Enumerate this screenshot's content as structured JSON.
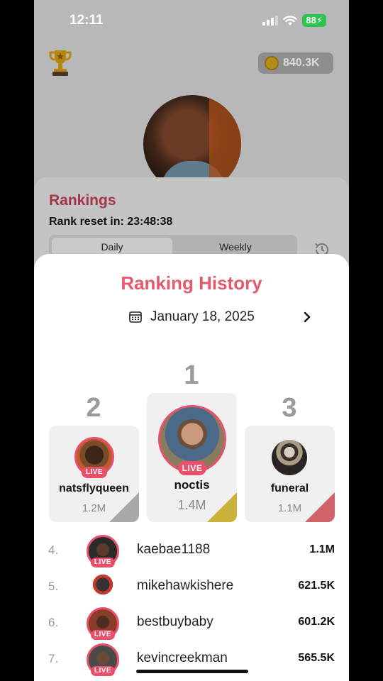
{
  "status": {
    "time": "12:11",
    "battery": "88"
  },
  "header": {
    "coins": "840.3K"
  },
  "rankings": {
    "title": "Rankings",
    "reset_text": "Rank reset in: 23:48:38",
    "tabs": [
      "Daily",
      "Weekly"
    ]
  },
  "history": {
    "title": "Ranking History",
    "date": "January 18, 2025",
    "podium": [
      {
        "place": "1",
        "name": "noctis",
        "score": "1.4M",
        "live": "LIVE"
      },
      {
        "place": "2",
        "name": "natsflyqueen",
        "score": "1.2M",
        "live": "LIVE"
      },
      {
        "place": "3",
        "name": "funeral",
        "score": "1.1M"
      }
    ],
    "list": [
      {
        "rank": "4.",
        "name": "kaebae1188",
        "score": "1.1M",
        "live": "LIVE"
      },
      {
        "rank": "5.",
        "name": "mikehawkishere",
        "score": "621.5K"
      },
      {
        "rank": "6.",
        "name": "bestbuybaby",
        "score": "601.2K",
        "live": "LIVE"
      },
      {
        "rank": "7.",
        "name": "kevincreekman",
        "score": "565.5K",
        "live": "LIVE"
      }
    ]
  },
  "colors": {
    "accent": "#e65a6f",
    "gold": "#c9b13a",
    "silver": "#a9a9a9",
    "bronze": "#d0636a"
  }
}
